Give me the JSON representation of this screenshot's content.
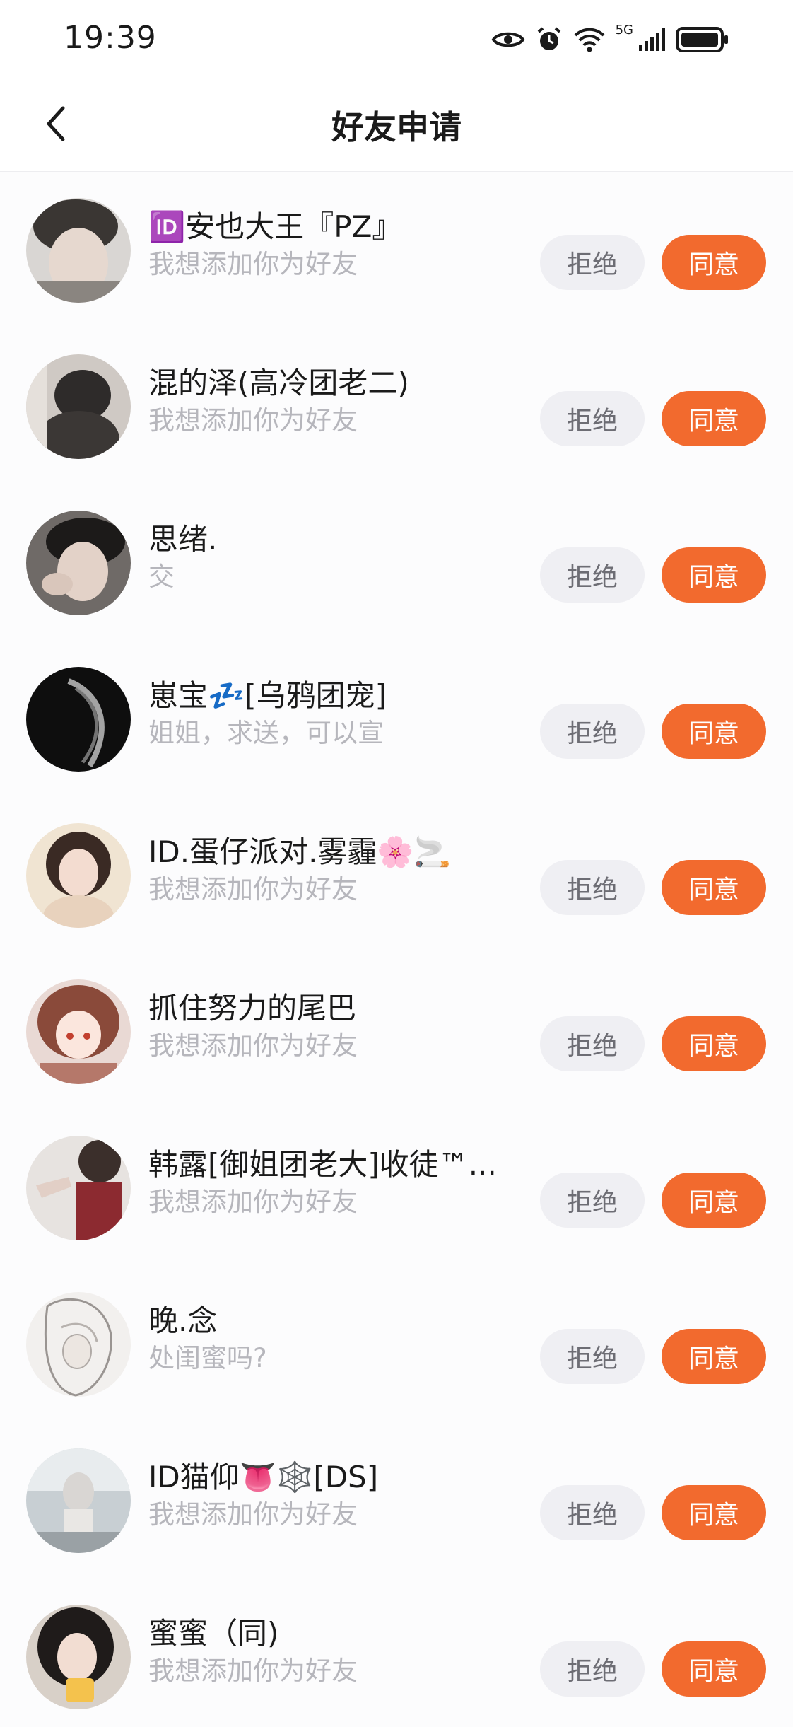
{
  "status_bar": {
    "time": "19:39",
    "network_label": "5G",
    "signal_extra": "6"
  },
  "header": {
    "title": "好友申请",
    "back_icon": "chevron-left-icon"
  },
  "buttons": {
    "reject_label": "拒绝",
    "accept_label": "同意"
  },
  "colors": {
    "accent": "#f26a2e",
    "reject_bg": "#efeff3",
    "secondary_text": "#b6b6bc"
  },
  "requests": [
    {
      "name": "🆔安也大王『PZ』",
      "message": "我想添加你为好友"
    },
    {
      "name": "混的泽(高冷团老二)",
      "message": "我想添加你为好友"
    },
    {
      "name": "思绪.",
      "message": "交"
    },
    {
      "name": "崽宝💤[乌鸦团宠]",
      "message": "姐姐，求送，可以宣"
    },
    {
      "name": "ID.蛋仔派对.雾霾🌸🚬",
      "message": "我想添加你为好友"
    },
    {
      "name": "抓住努力的尾巴",
      "message": "我想添加你为好友"
    },
    {
      "name": "韩露[御姐团老大]收徒™...",
      "message": "我想添加你为好友"
    },
    {
      "name": "晚.念",
      "message": "处闺蜜吗?"
    },
    {
      "name": "ID猫仰👅🕸️[DS]",
      "message": "我想添加你为好友"
    },
    {
      "name": "蜜蜜（同)",
      "message": "我想添加你为好友"
    }
  ]
}
